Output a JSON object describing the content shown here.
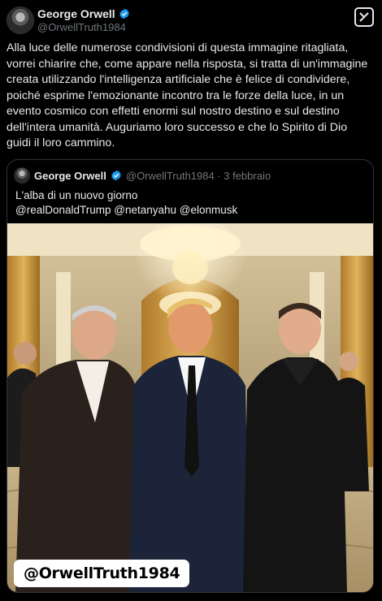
{
  "post": {
    "author_name": "George Orwell",
    "author_handle": "@OrwellTruth1984",
    "text": "Alla luce delle numerose condivisioni di questa immagine ritagliata, vorrei chiarire che, come appare nella risposta, si tratta di un'immagine creata utilizzando l'intelligenza artificiale che è felice di condividere, poiché esprime l'emozionante incontro tra le forze della luce, in un evento cosmico con effetti enormi sul nostro destino e sul destino dell'intera umanità. Auguriamo loro successo e che lo Spirito di Dio guidi il loro cammino.",
    "verified_icon": "verified-badge-icon",
    "grok_icon": "grok-icon"
  },
  "quoted": {
    "author_name": "George Orwell",
    "meta": "@OrwellTruth1984 · 3 febbraio",
    "text": "L'alba di un nuovo giorno",
    "mentions": " @realDonaldTrump @netanyahu @elonmusk",
    "watermark": "@OrwellTruth1984"
  },
  "colors": {
    "background": "#000000",
    "verified": "#1d9bf0",
    "secondary_text": "#71767b"
  }
}
